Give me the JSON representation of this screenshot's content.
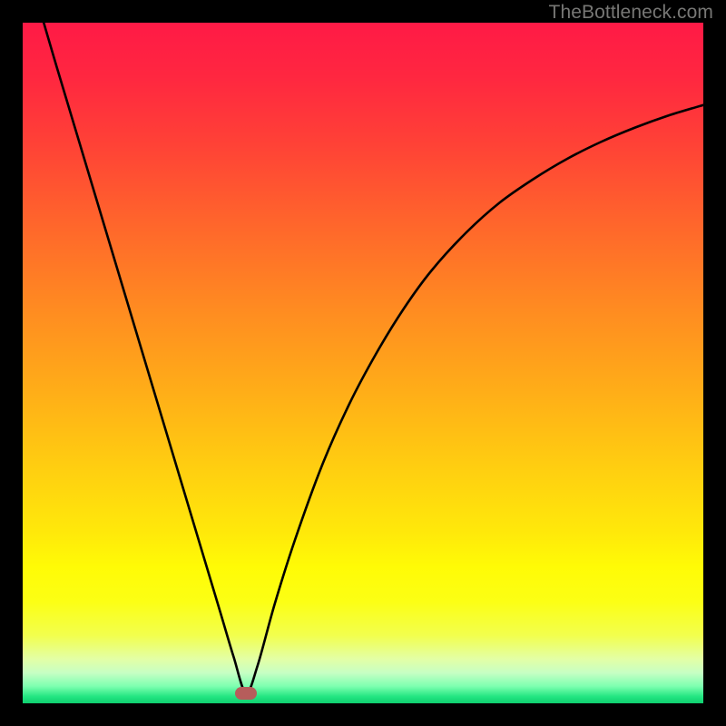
{
  "watermark": "TheBottleneck.com",
  "gradient": {
    "stops": [
      {
        "offset": 0.0,
        "color": "#ff1a46"
      },
      {
        "offset": 0.08,
        "color": "#ff2740"
      },
      {
        "offset": 0.18,
        "color": "#ff4236"
      },
      {
        "offset": 0.3,
        "color": "#ff672b"
      },
      {
        "offset": 0.42,
        "color": "#ff8b21"
      },
      {
        "offset": 0.54,
        "color": "#ffad18"
      },
      {
        "offset": 0.66,
        "color": "#ffd010"
      },
      {
        "offset": 0.75,
        "color": "#ffe90a"
      },
      {
        "offset": 0.8,
        "color": "#fffb06"
      },
      {
        "offset": 0.85,
        "color": "#fcff14"
      },
      {
        "offset": 0.9,
        "color": "#f2ff4d"
      },
      {
        "offset": 0.935,
        "color": "#e3ffa6"
      },
      {
        "offset": 0.955,
        "color": "#c7ffc4"
      },
      {
        "offset": 0.975,
        "color": "#7dffb0"
      },
      {
        "offset": 0.99,
        "color": "#23e682"
      },
      {
        "offset": 1.0,
        "color": "#0fcf6f"
      }
    ]
  },
  "marker": {
    "x_frac": 0.328,
    "y_frac": 0.985,
    "color": "#b65d5b"
  },
  "chart_data": {
    "type": "line",
    "title": "",
    "xlabel": "",
    "ylabel": "",
    "xlim": [
      0,
      100
    ],
    "ylim": [
      0,
      100
    ],
    "series": [
      {
        "name": "bottleneck-curve",
        "x": [
          2.8,
          5,
          8,
          11,
          14,
          17,
          20,
          23,
          26,
          29,
          31,
          32.8,
          34.5,
          37,
          40,
          44,
          48,
          52,
          56,
          60,
          65,
          70,
          75,
          80,
          85,
          90,
          95,
          100
        ],
        "y": [
          101,
          93.5,
          83.5,
          73.5,
          63.5,
          53.5,
          43.5,
          33.5,
          23.5,
          13.5,
          6.8,
          1.5,
          5.5,
          14.5,
          24,
          35,
          44,
          51.5,
          58,
          63.5,
          69,
          73.5,
          77,
          80,
          82.5,
          84.6,
          86.4,
          87.9
        ]
      }
    ],
    "annotations": [
      {
        "type": "marker",
        "x": 32.8,
        "y": 1.5,
        "label": "optimal-point"
      }
    ]
  }
}
